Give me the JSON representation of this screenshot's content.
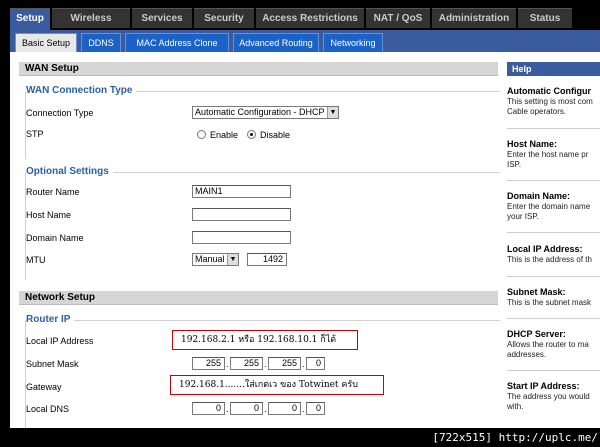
{
  "top_tabs": [
    {
      "label": "Setup",
      "active": true
    },
    {
      "label": "Wireless"
    },
    {
      "label": "Services"
    },
    {
      "label": "Security"
    },
    {
      "label": "Access Restrictions"
    },
    {
      "label": "NAT / QoS"
    },
    {
      "label": "Administration"
    },
    {
      "label": "Status"
    }
  ],
  "sub_tabs": [
    {
      "label": "Basic Setup",
      "active": true
    },
    {
      "label": "DDNS"
    },
    {
      "label": "MAC Address Clone"
    },
    {
      "label": "Advanced Routing"
    },
    {
      "label": "Networking"
    }
  ],
  "wan": {
    "section_title": "WAN Setup",
    "conn_group_title": "WAN Connection Type",
    "conn_type_label": "Connection Type",
    "conn_type_value": "Automatic Configuration - DHCP",
    "stp_label": "STP",
    "stp_enable": "Enable",
    "stp_disable": "Disable",
    "optional_title": "Optional Settings",
    "router_name_label": "Router Name",
    "router_name_value": "MAIN1",
    "host_name_label": "Host Name",
    "host_name_value": "",
    "domain_name_label": "Domain Name",
    "domain_name_value": "",
    "mtu_label": "MTU",
    "mtu_mode": "Manual",
    "mtu_value": "1492"
  },
  "network": {
    "section_title": "Network Setup",
    "router_ip_title": "Router IP",
    "local_ip_label": "Local IP Address",
    "local_ip_note": "192.168.2.1 หรือ 192.168.10.1 ก็ได้",
    "subnet_label": "Subnet Mask",
    "subnet": [
      "255",
      "255",
      "255",
      "0"
    ],
    "gateway_label": "Gateway",
    "gateway_note": "192.168.1.......ใส่เกตเว ของ Totwinet ครับ",
    "local_dns_label": "Local DNS",
    "local_dns": [
      "0",
      "0",
      "0",
      "0"
    ]
  },
  "help": {
    "title": "Help",
    "items": [
      {
        "title": "Automatic Configur",
        "desc": [
          "This setting is most com",
          "Cable operators."
        ]
      },
      {
        "title": "Host Name:",
        "desc": [
          "Enter the host name pr",
          "ISP."
        ]
      },
      {
        "title": "Domain Name:",
        "desc": [
          "Enter the domain name",
          "your ISP."
        ]
      },
      {
        "title": "Local IP Address:",
        "desc": [
          "This is the address of th"
        ]
      },
      {
        "title": "Subnet Mask:",
        "desc": [
          "This is the subnet mask"
        ]
      },
      {
        "title": "DHCP Server:",
        "desc": [
          "Allows the router to ma",
          "addresses."
        ]
      },
      {
        "title": "Start IP Address:",
        "desc": [
          "The address you would",
          "with."
        ]
      }
    ]
  },
  "watermark": "[722x515] http://uplc.me/",
  "colors": {
    "tab_blue": "#3a5c9f",
    "subtab_blue": "#1a62c5",
    "group_title": "#2a5fa8",
    "callout_border": "#cc0000"
  }
}
